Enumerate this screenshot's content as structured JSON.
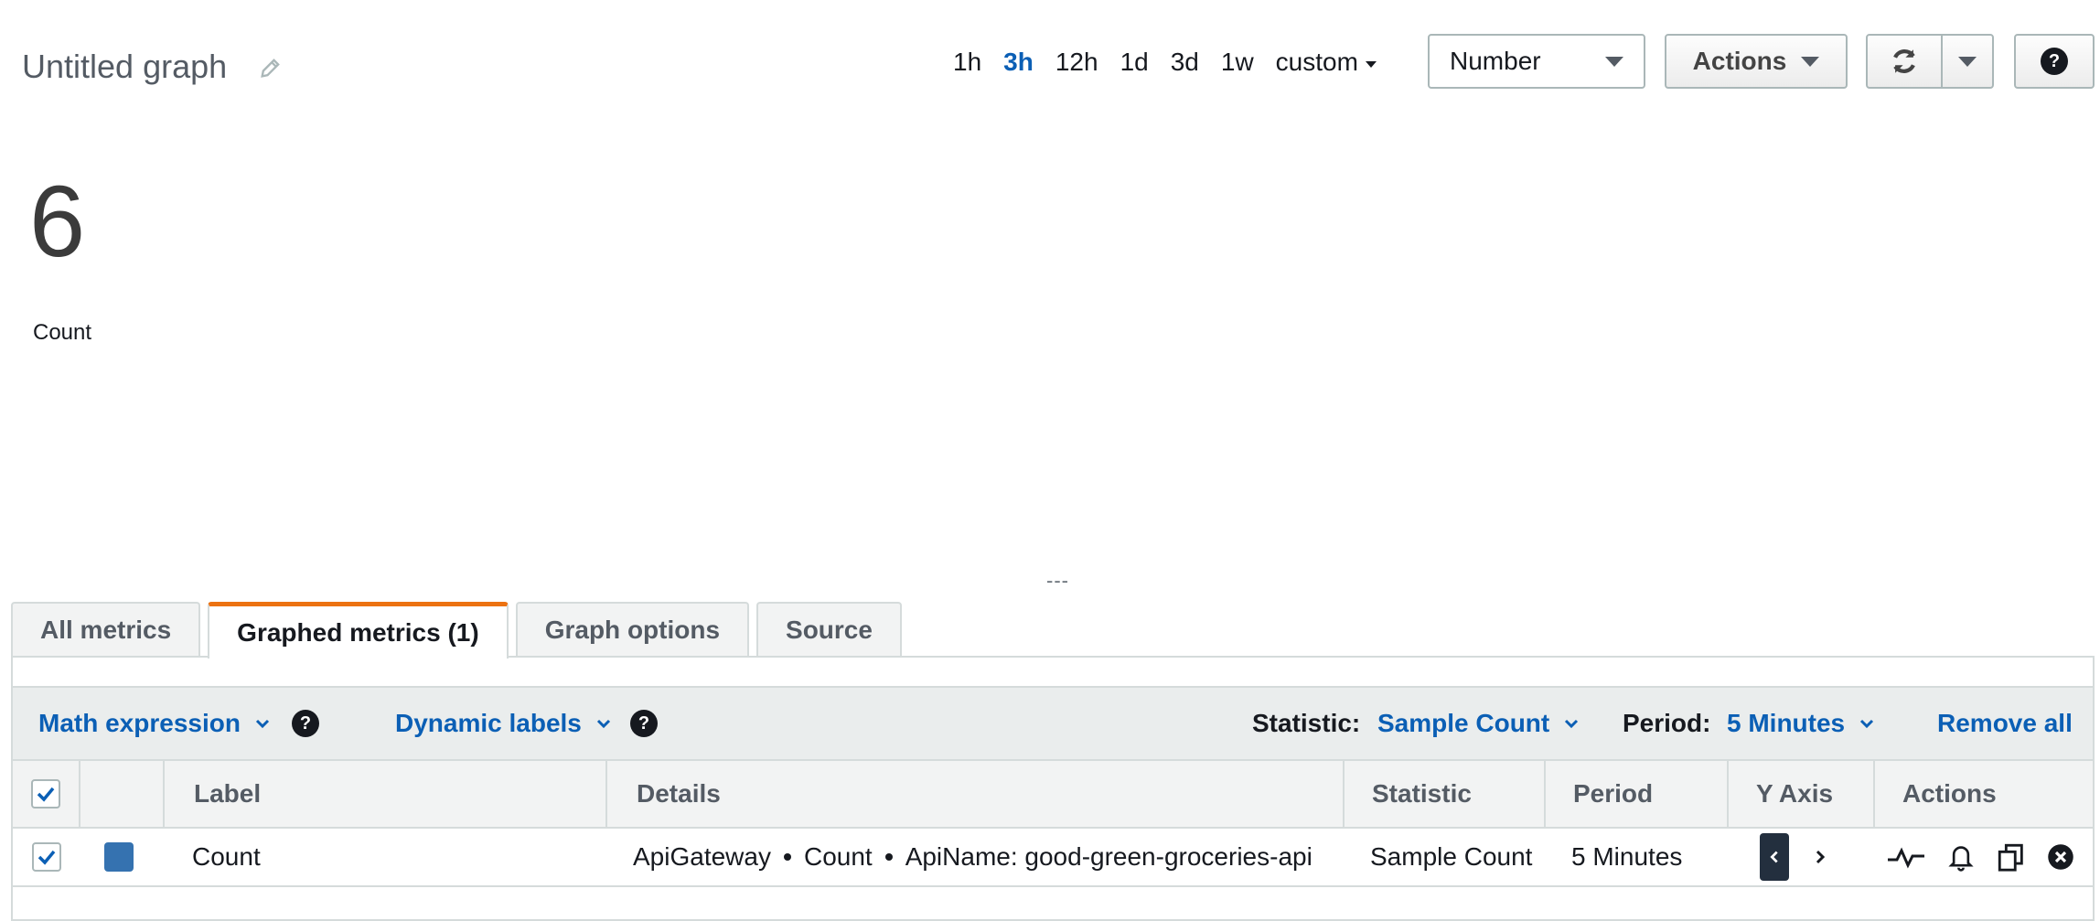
{
  "header": {
    "title": "Untitled graph",
    "time_ranges": [
      "1h",
      "3h",
      "12h",
      "1d",
      "3d",
      "1w"
    ],
    "active_range": "3h",
    "custom_label": "custom",
    "view_type": "Number",
    "actions_label": "Actions"
  },
  "widget": {
    "value": "6",
    "metric_label": "Count",
    "resize_handle": "---"
  },
  "tabs": [
    {
      "label": "All metrics",
      "active": false
    },
    {
      "label": "Graphed metrics (1)",
      "active": true
    },
    {
      "label": "Graph options",
      "active": false
    },
    {
      "label": "Source",
      "active": false
    }
  ],
  "toolbar": {
    "math_expression": "Math expression",
    "dynamic_labels": "Dynamic labels",
    "statistic_label": "Statistic:",
    "statistic_value": "Sample Count",
    "period_label": "Period:",
    "period_value": "5 Minutes",
    "remove_all": "Remove all"
  },
  "table": {
    "columns": [
      "Label",
      "Details",
      "Statistic",
      "Period",
      "Y Axis",
      "Actions"
    ],
    "rows": [
      {
        "checked": true,
        "color": "#3572b0",
        "label": "Count",
        "details": [
          "ApiGateway",
          "Count",
          "ApiName: good-green-groceries-api"
        ],
        "statistic": "Sample Count",
        "period": "5 Minutes"
      }
    ]
  },
  "colors": {
    "accent": "#0b5fb5",
    "tab_active": "#ec7211",
    "series": "#3572b0"
  }
}
